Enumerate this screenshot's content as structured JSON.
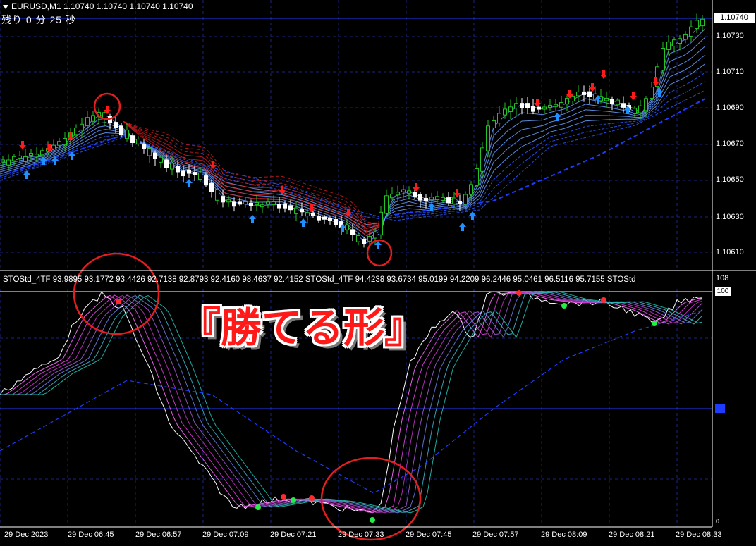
{
  "header": {
    "symbol_line": "EURUSD,M1  1.10740 1.10740 1.10740 1.10740",
    "timer": "残り  0 分  25 秒"
  },
  "price_axis": {
    "current_price": "1.10740",
    "labels": [
      "1.10730",
      "1.10710",
      "1.10690",
      "1.10670",
      "1.10650",
      "1.10630",
      "1.10610"
    ]
  },
  "indicator": {
    "label_line": "STOStd_4TF 93.9895 93.1772 93.4426 92.7138 92.8793 92.4160 98.4637 92.4152  STOStd_4TF 94.4238 93.6734 95.0199 94.2209 96.2446 95.0461 96.5116 95.7155  STOStd",
    "scale_max": "108",
    "level_top": "100",
    "level_bottom": "0"
  },
  "time_axis": [
    "29 Dec 2023",
    "29 Dec 06:45",
    "29 Dec 06:57",
    "29 Dec 07:09",
    "29 Dec 07:21",
    "29 Dec 07:33",
    "29 Dec 07:45",
    "29 Dec 07:57",
    "29 Dec 08:09",
    "29 Dec 08:21",
    "29 Dec 08:33"
  ],
  "overlay_title": "『勝てる形』",
  "colors": {
    "background": "#000000",
    "grid": "#1a237e",
    "bull_candle": "#22c322",
    "bear_candle": "#ffffff",
    "up_arrow": "#1e90ff",
    "down_arrow": "#ff1a1a",
    "highlight_circle": "#e41e1e",
    "ma_up": "#2a6cff",
    "ma_down": "#d81e1e"
  }
}
